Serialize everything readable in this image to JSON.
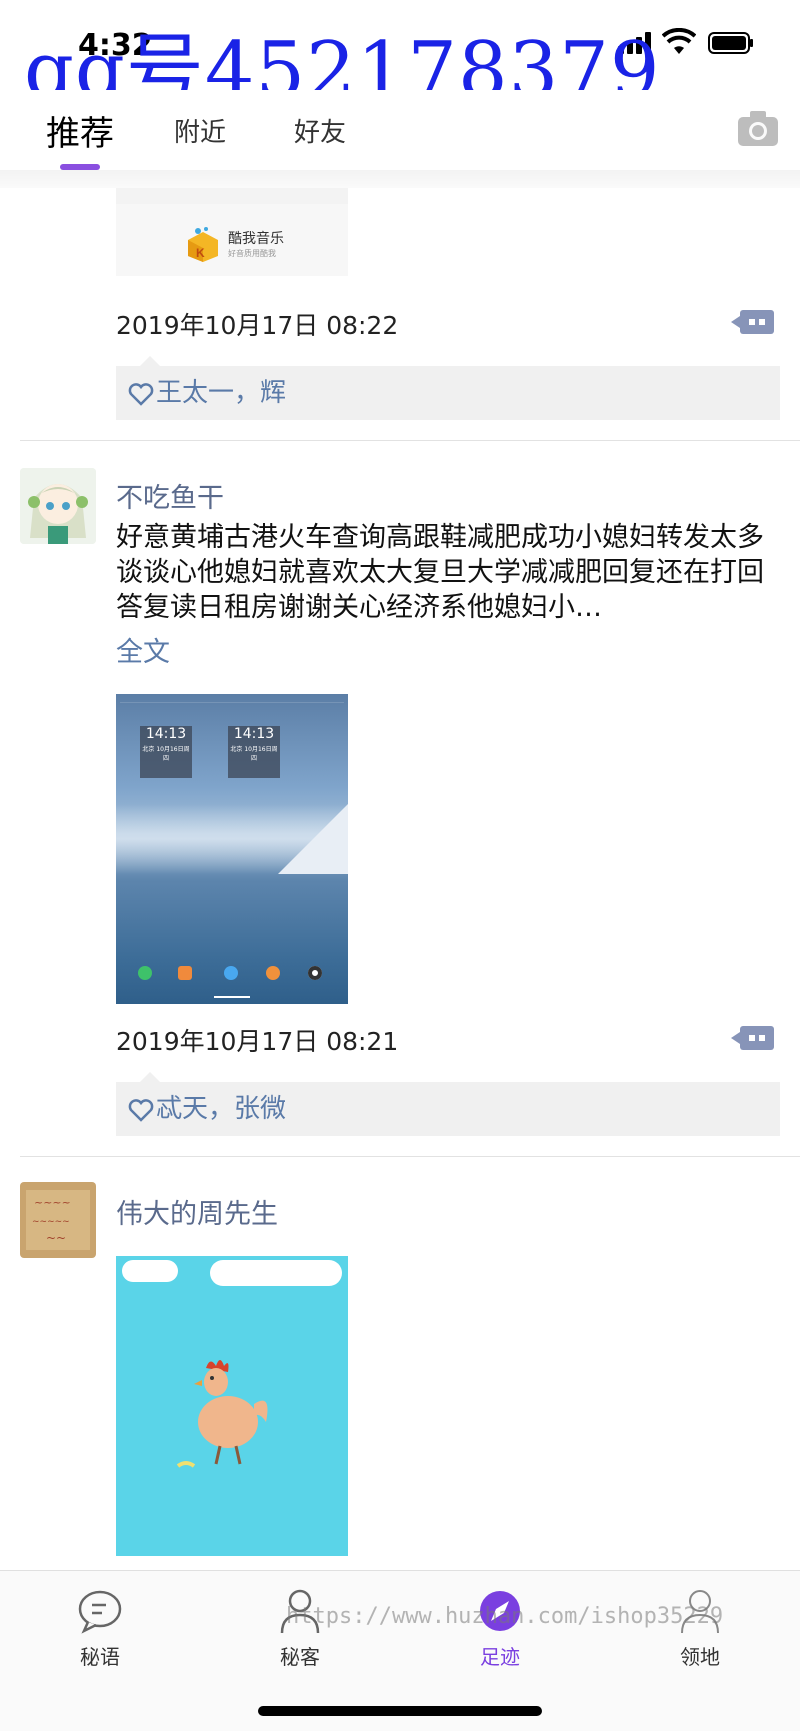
{
  "status_bar": {
    "time": "4:32"
  },
  "watermark_top": "qq号452178379",
  "top_tabs": [
    {
      "label": "推荐",
      "active": true
    },
    {
      "label": "附近",
      "active": false
    },
    {
      "label": "好友",
      "active": false
    }
  ],
  "accent_color": "#8a4fe0",
  "posts": [
    {
      "music_card": {
        "name": "酷我音乐",
        "subtitle": "好音质用酷我"
      },
      "timestamp": "2019年10月17日 08:22",
      "likes": "王太一，辉"
    },
    {
      "username": "不吃鱼干",
      "text": "好意黄埔古港火车查询高跟鞋减肥成功小媳妇转发太多谈谈心他媳妇就喜欢太大复旦大学减减肥回复还在打回答复读日租房谢谢关心经济系他媳妇小…",
      "full_text_link": "全文",
      "image_widgets": [
        {
          "time": "14:13",
          "city": "北京",
          "date": "10月16日周四"
        },
        {
          "time": "14:13",
          "city": "北京",
          "date": "10月16日周四"
        }
      ],
      "timestamp": "2019年10月17日 08:21",
      "likes": "忒天，张微"
    },
    {
      "username": "伟大的周先生"
    }
  ],
  "bottom_tabs": [
    {
      "label": "秘语",
      "icon": "chat-bubble-icon",
      "active": false
    },
    {
      "label": "秘客",
      "icon": "person-icon",
      "active": false
    },
    {
      "label": "足迹",
      "icon": "compass-icon",
      "active": true
    },
    {
      "label": "领地",
      "icon": "person-outline-icon",
      "active": false
    }
  ],
  "watermark_bottom": "https://www.huzhan.com/ishop35229"
}
